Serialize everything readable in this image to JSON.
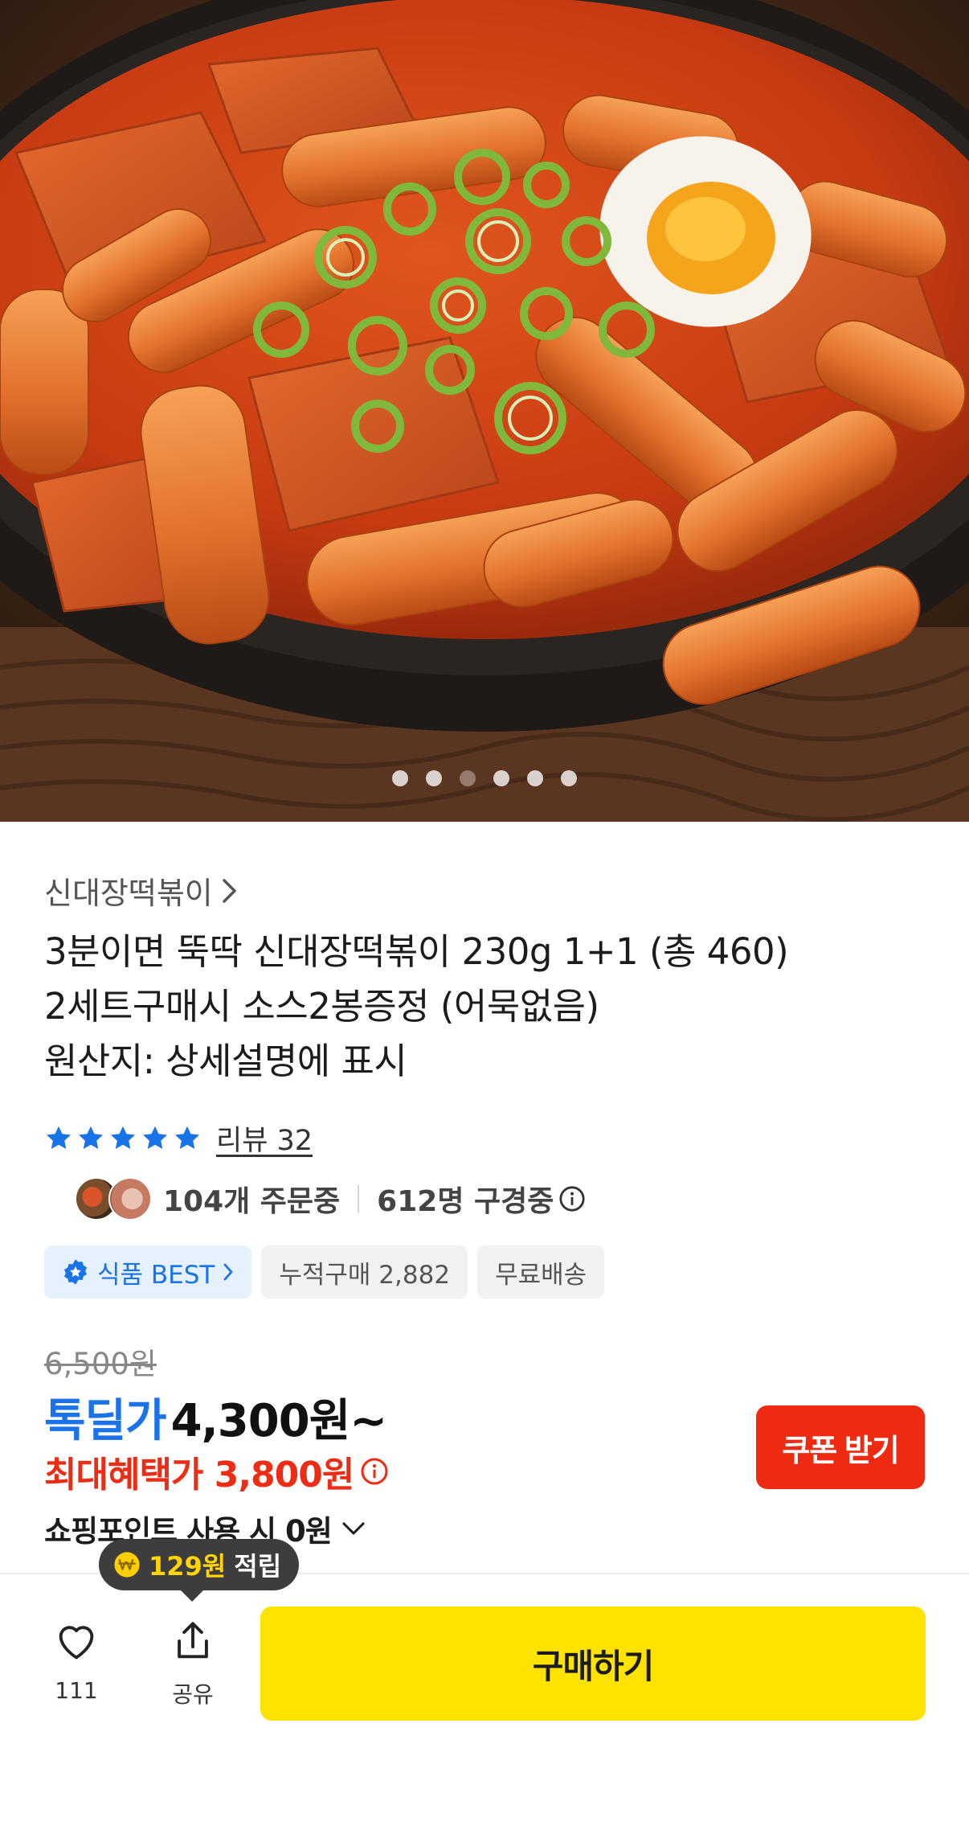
{
  "hero": {
    "image_alt": "",
    "carousel_count": 6,
    "active_index": 2
  },
  "product": {
    "brand": "신대장떡볶이",
    "title_lines": [
      "3분이면 뚝딱 신대장떡볶이 230g 1+1 (총 460)",
      "2세트구매시 소스2봉증정 (어묵없음)",
      "원산지: 상세설명에 표시"
    ],
    "rating_stars": 5,
    "review_label": "리뷰 32",
    "ordering": "104개 주문중",
    "viewing": "612명 구경중",
    "tags": {
      "best": "식품 BEST",
      "cumulative": "누적구매 2,882",
      "shipping": "무료배송"
    },
    "original_price": "6,500원",
    "price_label": "톡딜가",
    "price_value": "4,300원~",
    "max_benefit": "최대혜택가 3,800원",
    "coupon_button": "쿠폰 받기",
    "points": "쇼핑포인트 사용 시 0원"
  },
  "tooltip": {
    "amount": "129원",
    "label": "적립"
  },
  "bottom_bar": {
    "like_count": "111",
    "share_label": "공유",
    "buy_button": "구매하기"
  },
  "colors": {
    "accent_blue": "#1a73e8",
    "red": "#ec2c14",
    "buy_yellow": "#ffe300"
  }
}
